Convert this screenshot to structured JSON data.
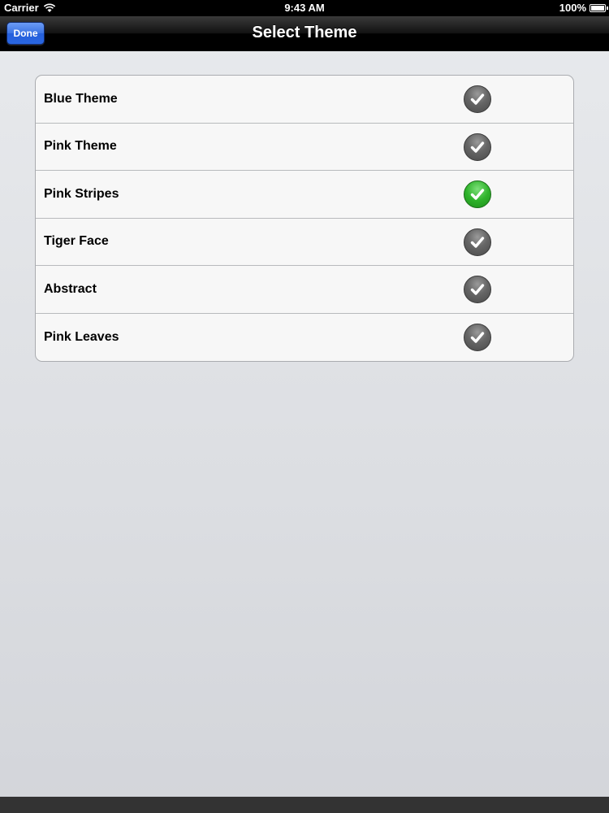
{
  "status_bar": {
    "carrier": "Carrier",
    "time": "9:43 AM",
    "battery": "100%"
  },
  "nav": {
    "done_label": "Done",
    "title": "Select Theme"
  },
  "themes": [
    {
      "label": "Blue Theme",
      "selected": false
    },
    {
      "label": "Pink Theme",
      "selected": false
    },
    {
      "label": "Pink Stripes",
      "selected": true
    },
    {
      "label": "Tiger Face",
      "selected": false
    },
    {
      "label": "Abstract",
      "selected": false
    },
    {
      "label": "Pink Leaves",
      "selected": false
    }
  ],
  "colors": {
    "selected_check": "#2fb32b",
    "unselected_check": "#5a5a5a",
    "done_button": "#3b73e3"
  },
  "icons": {
    "checkmark": "checkmark-icon",
    "wifi": "wifi-icon",
    "battery": "battery-icon"
  }
}
